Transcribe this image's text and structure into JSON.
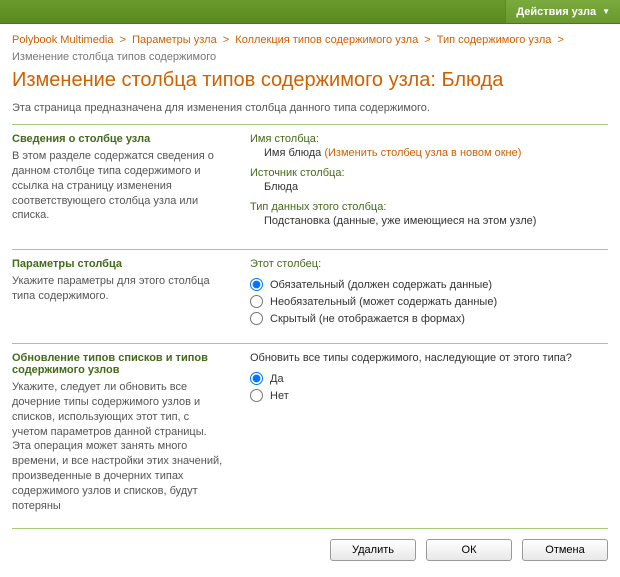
{
  "topbar": {
    "actions_label": "Действия узла"
  },
  "breadcrumb": {
    "items": [
      "Polybook Multimedia",
      "Параметры узла",
      "Коллекция типов содержимого узла",
      "Тип содержимого узла"
    ],
    "current": "Изменение столбца типов содержимого"
  },
  "title": "Изменение столбца типов содержимого узла: Блюда",
  "intro": "Эта страница предназначена для изменения столбца данного типа содержимого.",
  "section1": {
    "title": "Сведения о столбце узла",
    "desc": "В этом разделе содержатся сведения о данном столбце типа содержимого и ссылка на страницу изменения соответствующего столбца узла или списка.",
    "col_name_label": "Имя столбца:",
    "col_name_value": "Имя блюда",
    "col_name_link": "Изменить столбец узла в новом окне",
    "source_label": "Источник столбца:",
    "source_value": "Блюда",
    "datatype_label": "Тип данных этого столбца:",
    "datatype_value": "Подстановка (данные, уже имеющиеся на этом узле)"
  },
  "section2": {
    "title": "Параметры столбца",
    "desc": "Укажите параметры для этого столбца типа содержимого.",
    "group_label": "Этот столбец:",
    "opt_required": "Обязательный (должен содержать данные)",
    "opt_optional": "Необязательный (может содержать данные)",
    "opt_hidden": "Скрытый (не отображается в формах)",
    "selected": "required"
  },
  "section3": {
    "title": "Обновление типов списков и типов содержимого узлов",
    "desc": "Укажите, следует ли обновить все дочерние типы содержимого узлов и списков, использующих этот тип, с учетом параметров данной страницы. Эта операция может занять много времени, и все настройки этих значений, произведенные в дочерних типах содержимого узлов и списков, будут потеряны",
    "group_label": "Обновить все типы содержимого, наследующие от этого типа?",
    "opt_yes": "Да",
    "opt_no": "Нет",
    "selected": "yes"
  },
  "footer": {
    "delete": "Удалить",
    "ok": "ОК",
    "cancel": "Отмена"
  }
}
